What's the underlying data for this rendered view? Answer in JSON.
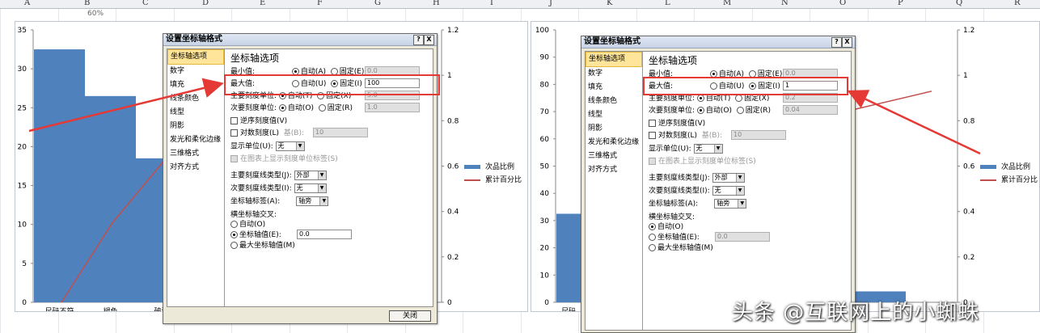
{
  "columns": [
    "A",
    "B",
    "C",
    "D",
    "E",
    "F",
    "G",
    "H",
    "I",
    "J",
    "K",
    "L",
    "M",
    "N",
    "O",
    "P",
    "Q",
    "R"
  ],
  "colors": {
    "bar": "#4f81bd",
    "line": "#c0504d",
    "arrow": "#e53935",
    "nav_selected": "#ffe59a"
  },
  "chart_data": [
    {
      "type": "bar",
      "left_axis_ticks": [
        "35",
        "30",
        "25",
        "20",
        "15",
        "10",
        "5",
        "0"
      ],
      "right_axis_ticks": [
        "1.2",
        "1",
        "0.8",
        "0.6",
        "0.4",
        "0.2",
        "0"
      ],
      "categories": [
        "尺码不符",
        "褪色",
        "破洞"
      ],
      "series": [
        {
          "name": "次品比例",
          "values": [
            32.5,
            26.5,
            18.5
          ]
        },
        {
          "name": "累计百分比",
          "values": [
            0,
            0.35,
            0.62
          ]
        }
      ],
      "ylim": [
        0,
        35
      ],
      "y2lim": [
        0,
        1.2
      ],
      "legend": "right"
    },
    {
      "type": "bar",
      "left_axis_ticks": [
        "100",
        "90",
        "80",
        "70",
        "60",
        "50",
        "40",
        "30",
        "20",
        "10",
        "0"
      ],
      "right_axis_ticks": [
        "1.2",
        "1",
        "0.8",
        "0.6",
        "0.4",
        "0.2",
        "0"
      ],
      "categories": [
        "尺码"
      ],
      "series": [
        {
          "name": "次品比例",
          "values": [
            32.5,
            4
          ]
        },
        {
          "name": "累计百分比",
          "values": [
            0.85,
            0.93
          ]
        }
      ],
      "ylim": [
        0,
        100
      ],
      "y2lim": [
        0,
        1.2
      ],
      "legend": "right"
    }
  ],
  "top_cut_label": "60%",
  "legend": {
    "series1": "次品比例",
    "series2": "累计百分比"
  },
  "dialog": {
    "title": "设置坐标轴格式",
    "help_btn": "?",
    "close_btn": "X",
    "nav": [
      "坐标轴选项",
      "数字",
      "填充",
      "线条颜色",
      "线型",
      "阴影",
      "发光和柔化边缘",
      "三维格式",
      "对齐方式"
    ],
    "section_title": "坐标轴选项",
    "min_label": "最小值:",
    "max_label": "最大值:",
    "major_label": "主要刻度单位:",
    "minor_label": "次要刻度单位:",
    "auto_a": "自动(A)",
    "fixed_e": "固定(E)",
    "auto_u": "自动(U)",
    "fixed_i": "固定(I)",
    "auto_t": "自动(T)",
    "fixed_x": "固定(X)",
    "auto_o": "自动(O)",
    "fixed_r": "固定(R)",
    "reverse": "逆序刻度值(V)",
    "log": "对数刻度(L)",
    "base": "基(B):",
    "base_val": "10",
    "display_unit": "显示单位(U):",
    "display_unit_val": "无",
    "show_unit_label": "在图表上显示刻度单位标签(S)",
    "major_type": "主要刻度线类型(J):",
    "major_type_val": "外部",
    "minor_type": "次要刻度线类型(I):",
    "minor_type_val": "无",
    "label_pos": "坐标轴标签(A):",
    "label_pos_val": "轴旁",
    "cross_title": "横坐标轴交叉:",
    "cross_auto": "自动(O)",
    "cross_value": "坐标轴值(E):",
    "cross_max": "最大坐标轴值(M)",
    "close_button": "关闭"
  },
  "dialog1_values": {
    "min": "0.0",
    "max": "100",
    "major": "5.0",
    "minor": "1.0",
    "cross_val": "0.0"
  },
  "dialog2_values": {
    "min": "0.0",
    "max": "1",
    "major": "0.2",
    "minor": "0.04",
    "cross_val": "0.0"
  },
  "watermark": "头条 @互联网上的小蜘蛛"
}
